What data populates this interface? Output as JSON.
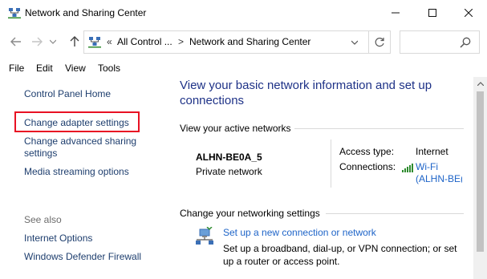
{
  "window": {
    "title": "Network and Sharing Center"
  },
  "address_bar": {
    "overflow": "«",
    "segments": [
      "All Control ...",
      "Network and Sharing Center"
    ],
    "separator": ">",
    "search_placeholder": ""
  },
  "menu": [
    "File",
    "Edit",
    "View",
    "Tools"
  ],
  "sidebar": {
    "links": [
      "Control Panel Home",
      "Change adapter settings",
      "Change advanced sharing",
      "settings",
      "Media streaming options"
    ],
    "see_also_label": "See also",
    "see_also_links": [
      "Internet Options",
      "Windows Defender Firewall"
    ]
  },
  "main": {
    "title_line1": "View your basic network information and set up",
    "title_line2": "connections",
    "active_networks_heading": "View your active networks",
    "network": {
      "name": "ALHN-BE0A_5",
      "category": "Private network",
      "access_type_label": "Access type:",
      "access_type_value": "Internet",
      "connections_label": "Connections:",
      "connection_line1": "Wi-Fi",
      "connection_line2": "(ALHN-BE("
    },
    "networking_settings_heading": "Change your networking settings",
    "setup_link": "Set up a new connection or network",
    "setup_desc_line1": "Set up a broadband, dial-up, or VPN connection; or set",
    "setup_desc_line2": "up a router or access point."
  },
  "icons": {
    "app": "network-icon",
    "search": "search-icon",
    "refresh": "refresh-icon",
    "wifi": "wifi-signal-icon"
  },
  "colors": {
    "title_blue": "#1e3287",
    "link_blue": "#1e64c8",
    "nav_link": "#1e3e6e",
    "highlight_red": "#e81123"
  }
}
